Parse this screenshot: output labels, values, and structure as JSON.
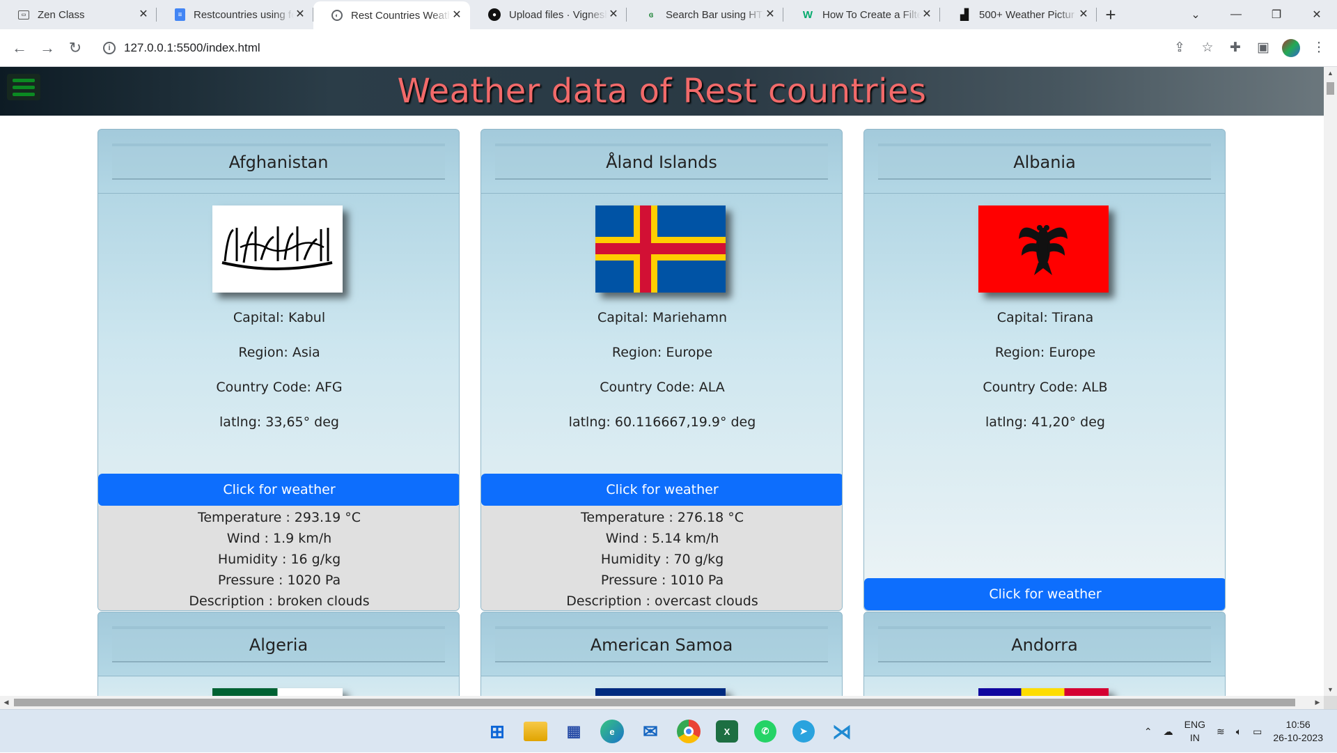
{
  "browser": {
    "tabs": [
      {
        "title": "Zen Class",
        "icon": "zen-class-icon",
        "active": false
      },
      {
        "title": "Restcountries using fe",
        "icon": "docs-icon",
        "active": false
      },
      {
        "title": "Rest Countries Weath",
        "icon": "globe-icon",
        "active": true
      },
      {
        "title": "Upload files · Vignesh",
        "icon": "github-icon",
        "active": false
      },
      {
        "title": "Search Bar using HTM",
        "icon": "gfg-icon",
        "active": false
      },
      {
        "title": "How To Create a Filte",
        "icon": "w3schools-icon",
        "active": false
      },
      {
        "title": "500+ Weather Pictur",
        "icon": "unsplash-icon",
        "active": false
      }
    ],
    "url": "127.0.0.1:5500/index.html"
  },
  "page": {
    "title": "Weather data of Rest countries",
    "accent_color": "#f26a6a",
    "button_color": "#0d6efd",
    "cards": [
      {
        "name": "Afghanistan",
        "capital": "Capital: Kabul",
        "region": "Region: Asia",
        "code": "Country Code: AFG",
        "latlng": "latlng: 33,65° deg",
        "button": "Click for weather",
        "weather": {
          "temperature": "Temperature : 293.19 °C",
          "wind": "Wind : 1.9 km/h",
          "humidity": "Humidity : 16 g/kg",
          "pressure": "Pressure : 1020 Pa",
          "description": "Description : broken clouds"
        }
      },
      {
        "name": "Åland Islands",
        "capital": "Capital: Mariehamn",
        "region": "Region: Europe",
        "code": "Country Code: ALA",
        "latlng": "latlng: 60.116667,19.9° deg",
        "button": "Click for weather",
        "weather": {
          "temperature": "Temperature : 276.18 °C",
          "wind": "Wind : 5.14 km/h",
          "humidity": "Humidity : 70 g/kg",
          "pressure": "Pressure : 1010 Pa",
          "description": "Description : overcast clouds"
        }
      },
      {
        "name": "Albania",
        "capital": "Capital: Tirana",
        "region": "Region: Europe",
        "code": "Country Code: ALB",
        "latlng": "latlng: 41,20° deg",
        "button": "Click for weather"
      },
      {
        "name": "Algeria"
      },
      {
        "name": "American Samoa"
      },
      {
        "name": "Andorra"
      }
    ]
  },
  "taskbar": {
    "apps": [
      "windows-start-icon",
      "file-explorer-icon",
      "remote-desktop-icon",
      "edge-icon",
      "mail-icon",
      "chrome-icon",
      "excel-icon",
      "whatsapp-icon",
      "telegram-icon",
      "vscode-icon"
    ],
    "lang_top": "ENG",
    "lang_bottom": "IN",
    "time": "10:56",
    "date": "26-10-2023"
  }
}
